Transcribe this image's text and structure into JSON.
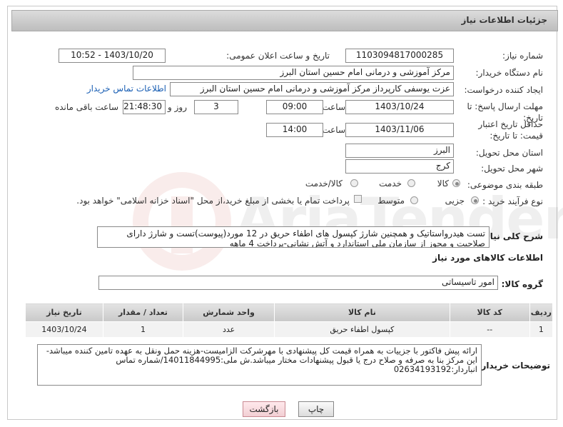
{
  "header": {
    "title": "جزئیات اطلاعات نیاز"
  },
  "labels": {
    "need_number": "شماره نیاز:",
    "announce_datetime": "تاریخ و ساعت اعلان عمومی:",
    "buyer_org": "نام دستگاه خریدار:",
    "requester": "ایجاد کننده درخواست:",
    "reply_deadline": "مهلت ارسال پاسخ: تا تاریخ:",
    "time": "ساعت",
    "day_and": "روز و",
    "hours_remaining": "ساعت باقی مانده",
    "price_validity": "حداقل تاریخ اعتبار قیمت: تا تاریخ:",
    "province": "استان محل تحویل:",
    "city": "شهر محل تحویل:",
    "category": "طبقه بندی موضوعی:",
    "process_type": "نوع فرآیند خرید :",
    "description": "شرح کلی نیاز:",
    "goods_info": "اطلاعات کالاهای مورد نیاز",
    "goods_group": "گروه کالا:",
    "buyer_notes": "توضیحات خریدار:"
  },
  "fields": {
    "need_number": "1103094817000285",
    "announce_datetime": "1403/10/20 - 10:52",
    "buyer_org": "مرکز آموزشی و درمانی امام حسین استان البرز",
    "requester": "عزت یوسفی کارپرداز مرکز آموزشی و درمانی امام حسین استان البرز",
    "contact_link": "اطلاعات تماس خریدار",
    "reply_date": "1403/10/24",
    "reply_time": "09:00",
    "days_remaining": "3",
    "time_remaining": "21:48:30",
    "validity_date": "1403/11/06",
    "validity_time": "14:00",
    "province": "البرز",
    "city": "کرج"
  },
  "category_options": [
    {
      "label": "کالا",
      "selected": true
    },
    {
      "label": "خدمت",
      "selected": false
    },
    {
      "label": "کالا/خدمت",
      "selected": false
    }
  ],
  "process_options": [
    {
      "label": "جزیی",
      "selected": true
    },
    {
      "label": "متوسط",
      "selected": false
    }
  ],
  "payment_note": "پرداخت تمام یا بخشی از مبلغ خرید،از محل \"اسناد خزانه اسلامی\" خواهد بود.",
  "description_text": "تست هیدرواستاتیک و همچنین شارژ کپسول های اطفاء حریق در 12 مورد(پیوست)تست و شارژ دارای صلاحیت و مجوز از سازمان ملی استاندارد و آتش نشانی-پرداخت 4 ماهه",
  "goods_group_value": "امور تاسیساتی",
  "table": {
    "headers": [
      "ردیف",
      "کد کالا",
      "نام کالا",
      "واحد شمارش",
      "تعداد / مقدار",
      "تاریخ نیاز"
    ],
    "rows": [
      [
        "1",
        "--",
        "کپسول اطفاء حریق",
        "عدد",
        "1",
        "1403/10/24"
      ]
    ]
  },
  "buyer_notes_text": "ارائه پیش فاکتور با جزییات به همراه قیمت کل پیشنهادی با مهرشرکت الزامیست-هزینه حمل ونقل به عهده تامین کننده میباشد-این مرکز بنا به صرفه و صلاح درج یا قبول پیشنهادات مختار میباشد.ش ملی:14011844995/شماره تماس انباردار:02634193192",
  "buttons": {
    "print": "چاپ",
    "back": "بازگشت"
  },
  "watermark": {
    "text": "AriaTender.net"
  }
}
